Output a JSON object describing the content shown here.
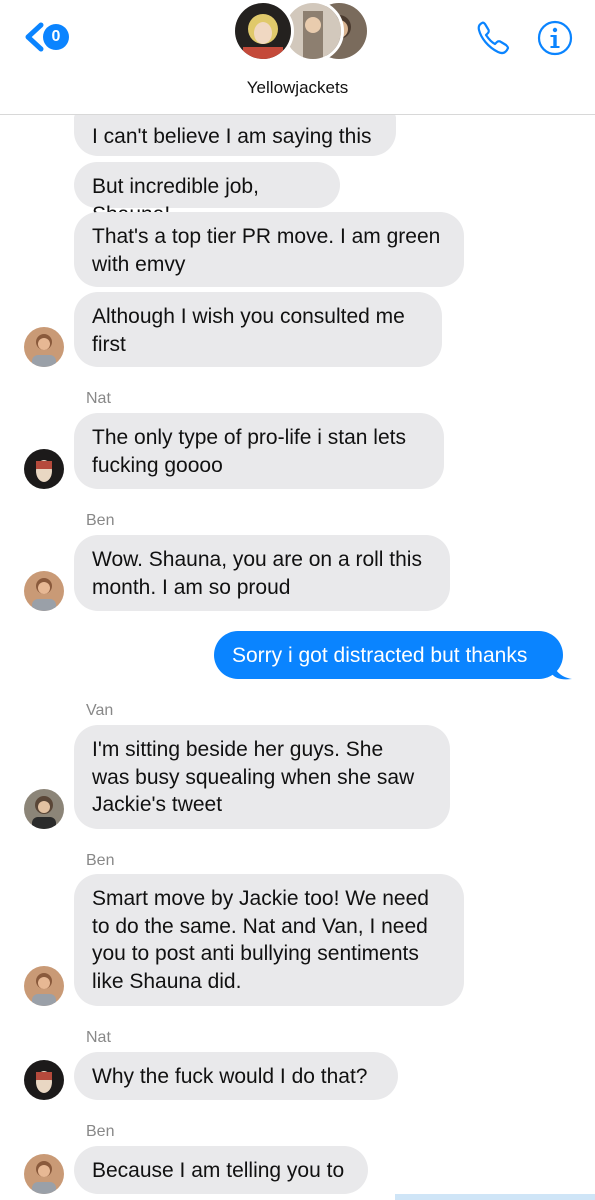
{
  "header": {
    "title": "Yellowjackets",
    "unread_count": "0",
    "back_icon": "chevron-left-icon",
    "call_icon": "phone-icon",
    "info_icon": "info-icon"
  },
  "colors": {
    "accent": "#0a84ff",
    "incoming_bubble": "#e9e9eb",
    "sender_label": "#888888"
  },
  "messages": [
    {
      "text": "I can't believe I am saying this"
    },
    {
      "text": "But incredible job, Shauna!"
    },
    {
      "text": "That's a top tier PR move. I am green\nwith emvy"
    },
    {
      "text": "Although I wish you consulted me\nfirst"
    },
    {
      "sender": "Nat",
      "text": "The only type of pro-life i stan lets\nfucking goooo"
    },
    {
      "sender": "Ben",
      "text": "Wow. Shauna, you are on a roll this\nmonth. I am so proud"
    },
    {
      "text": "Sorry i got distracted but thanks"
    },
    {
      "sender": "Van",
      "text": "I'm sitting beside her guys. She\nwas busy squealing when she saw\nJackie's tweet"
    },
    {
      "sender": "Ben",
      "text": "Smart move by Jackie too! We need\nto do the same. Nat and Van, I need\nyou to post anti bullying sentiments\nlike Shauna did."
    },
    {
      "sender": "Nat",
      "text": "Why the fuck would I do that?"
    },
    {
      "sender": "Ben",
      "text": "Because I am telling you to"
    }
  ]
}
